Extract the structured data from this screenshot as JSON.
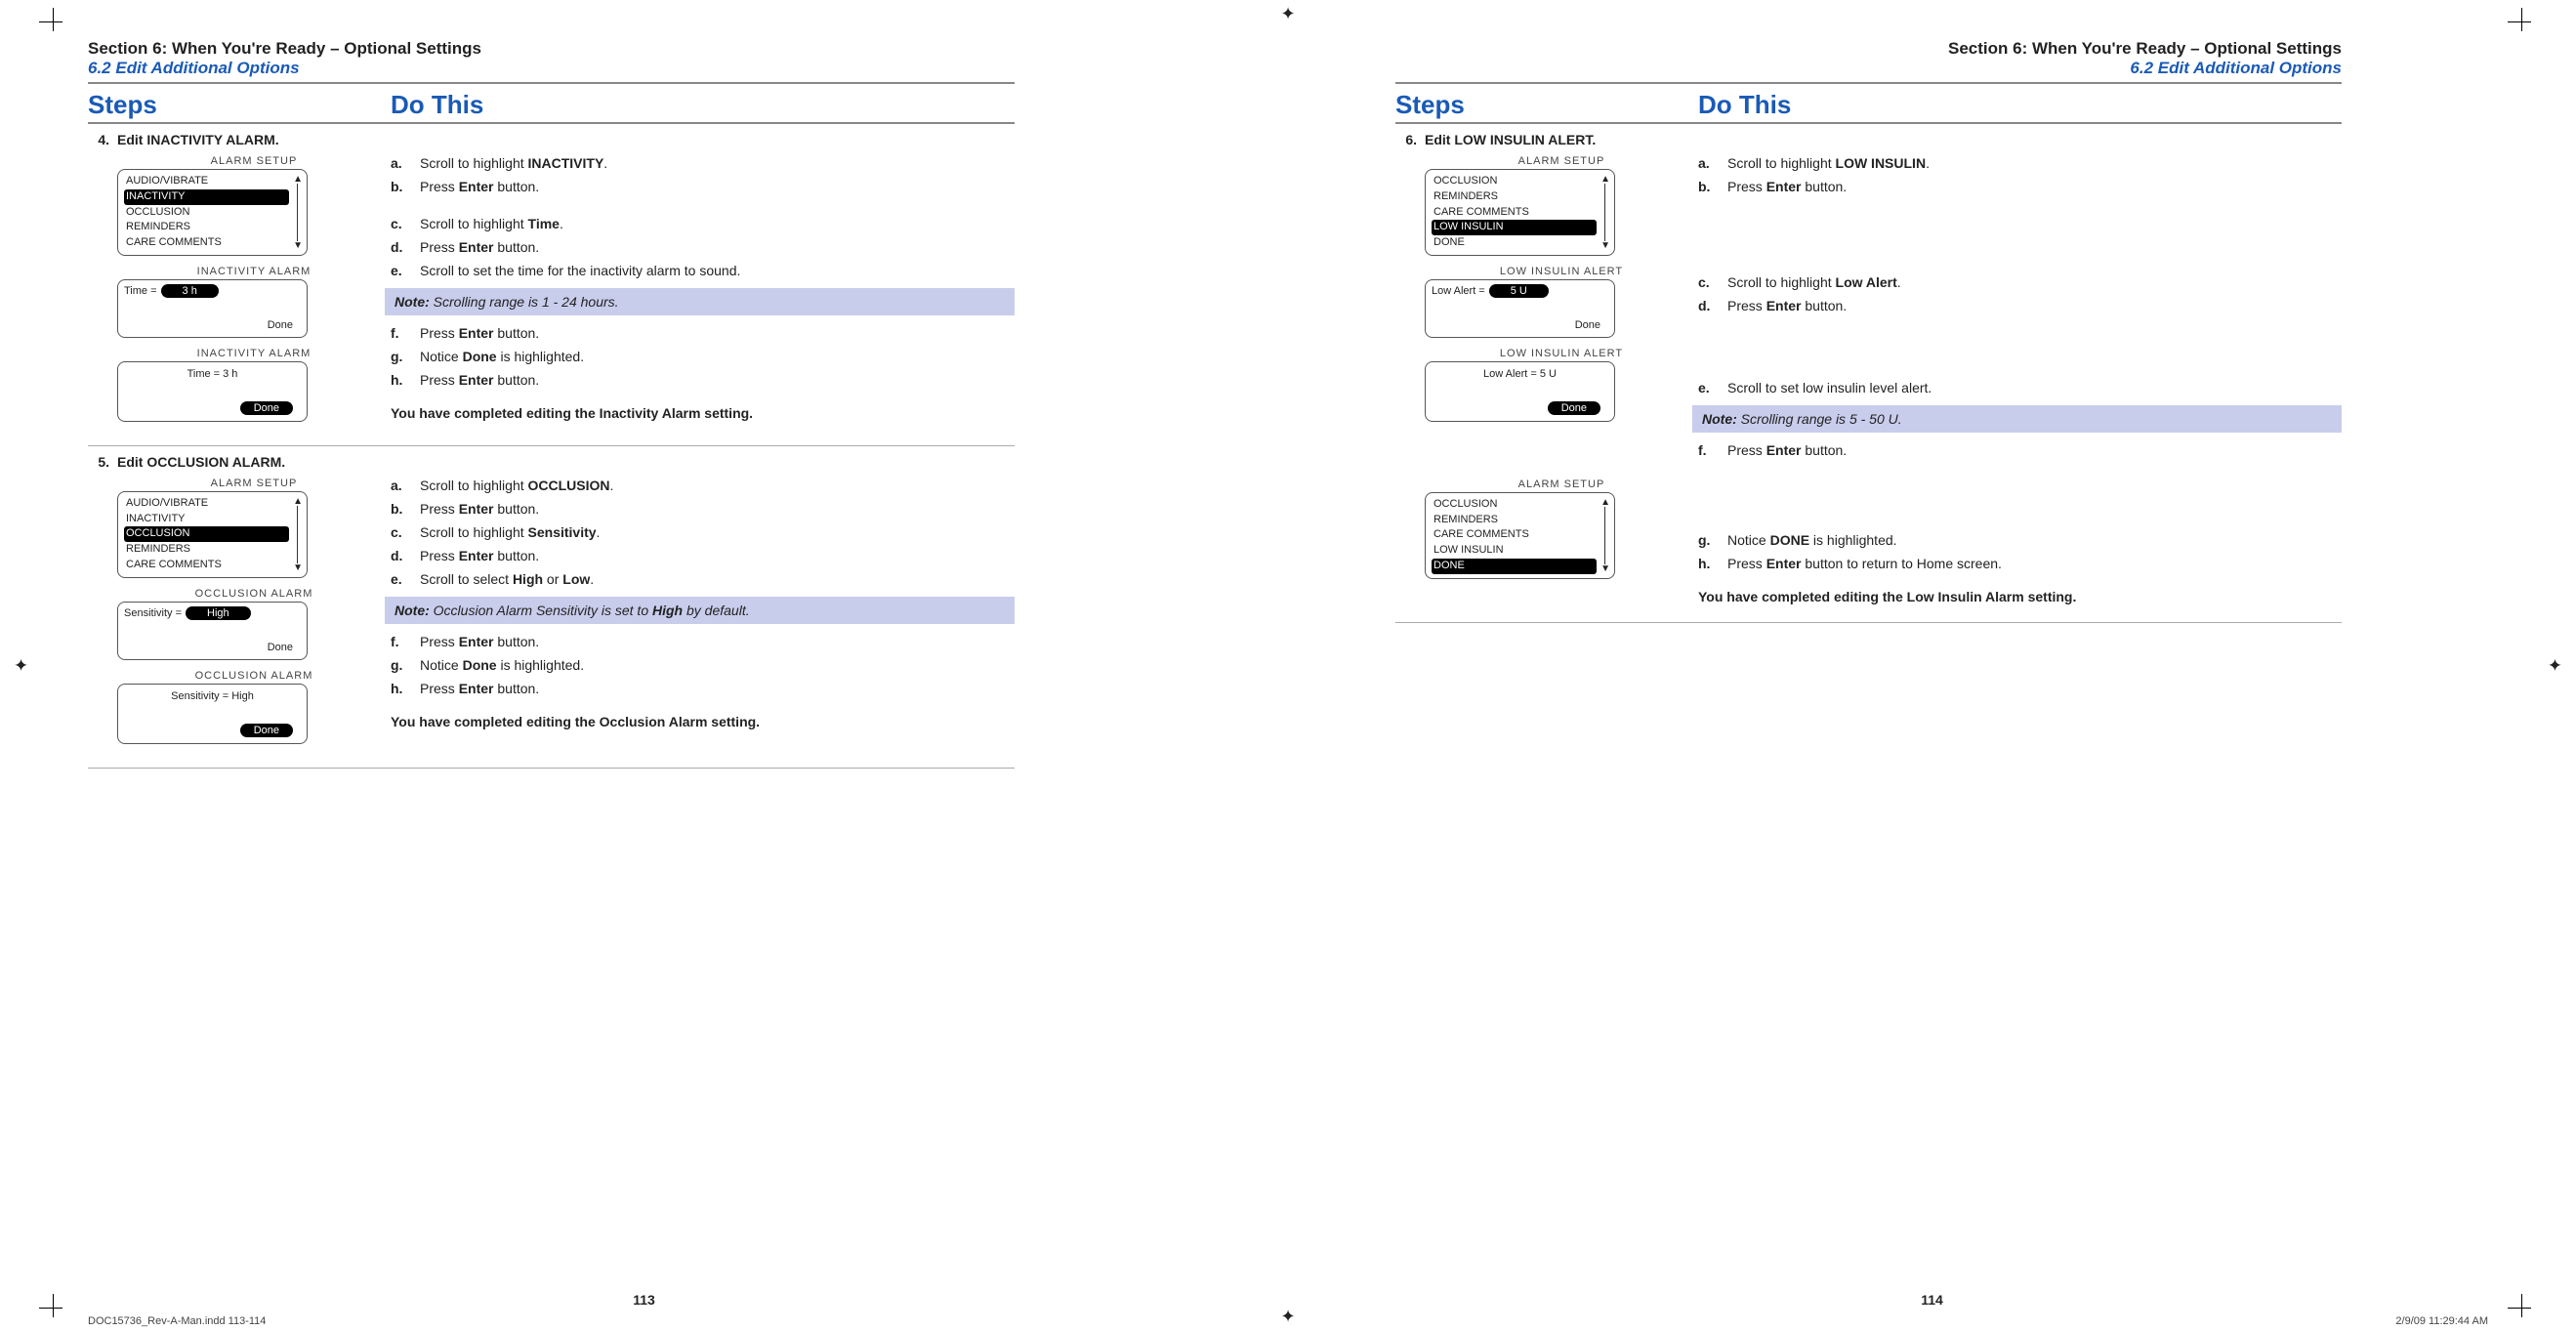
{
  "section_title": "Section 6: When You're Ready – Optional Settings",
  "subsection_title": "6.2 Edit Additional Options",
  "cols": {
    "steps": "Steps",
    "do": "Do This"
  },
  "left": {
    "pageno": "113",
    "steps": [
      {
        "num": "4.",
        "title": "Edit INACTIVITY ALARM.",
        "screens": [
          {
            "title": "ALARM SETUP",
            "type": "menu",
            "items": [
              "AUDIO/VIBRATE",
              "INACTIVITY",
              "OCCLUSION",
              "REMINDERS",
              "CARE COMMENTS"
            ],
            "sel": 1
          },
          {
            "title": "INACTIVITY ALARM",
            "type": "value",
            "key": "Time =",
            "val": "3 h",
            "done_plain": "Done"
          },
          {
            "title": "INACTIVITY ALARM",
            "type": "static",
            "line": "Time = 3 h",
            "done_pill": "Done"
          }
        ],
        "subs": [
          {
            "l": "a.",
            "t_a": "Scroll to highlight ",
            "t_b": "INACTIVITY",
            "t_c": "."
          },
          {
            "l": "b.",
            "t_a": "Press ",
            "t_b": "Enter",
            "t_c": " button."
          },
          {
            "gap": true
          },
          {
            "l": "c.",
            "t_a": "Scroll to highlight ",
            "t_b": "Time",
            "t_c": "."
          },
          {
            "l": "d.",
            "t_a": "Press ",
            "t_b": "Enter",
            "t_c": " button."
          },
          {
            "l": "e.",
            "t_a": "Scroll to set the time for the inactivity alarm to sound.",
            "t_b": "",
            "t_c": ""
          },
          {
            "note_a": "Note:",
            "note_b": " Scrolling range is 1 - 24 hours."
          },
          {
            "l": "f.",
            "t_a": "Press ",
            "t_b": "Enter",
            "t_c": " button."
          },
          {
            "l": "g.",
            "t_a": "Notice ",
            "t_b": "Done",
            "t_c": " is highlighted."
          },
          {
            "l": "h.",
            "t_a": "Press ",
            "t_b": "Enter",
            "t_c": " button."
          }
        ],
        "complete": "You have completed editing the Inactivity Alarm setting."
      },
      {
        "num": "5.",
        "title": "Edit OCCLUSION ALARM.",
        "screens": [
          {
            "title": "ALARM SETUP",
            "type": "menu",
            "items": [
              "AUDIO/VIBRATE",
              "INACTIVITY",
              "OCCLUSION",
              "REMINDERS",
              "CARE COMMENTS"
            ],
            "sel": 2
          },
          {
            "title": "OCCLUSION ALARM",
            "type": "value",
            "key": "Sensitivity =",
            "val": "High",
            "done_plain": "Done"
          },
          {
            "title": "OCCLUSION ALARM",
            "type": "static",
            "line": "Sensitivity = High",
            "done_pill": "Done"
          }
        ],
        "subs": [
          {
            "l": "a.",
            "t_a": "Scroll to highlight ",
            "t_b": "OCCLUSION",
            "t_c": "."
          },
          {
            "l": "b.",
            "t_a": "Press ",
            "t_b": "Enter",
            "t_c": " button."
          },
          {
            "l": "c.",
            "t_a": "Scroll to highlight ",
            "t_b": "Sensitivity",
            "t_c": "."
          },
          {
            "l": "d.",
            "t_a": "Press ",
            "t_b": "Enter",
            "t_c": " button."
          },
          {
            "l": "e.",
            "t_a": "Scroll to select ",
            "t_b": "High",
            "t_c": " or ",
            "t_d": "Low",
            "t_e": "."
          },
          {
            "note_a": "Note:",
            "note_b": " Occlusion Alarm Sensitivity is set to ",
            "note_c": "High",
            "note_d": " by default."
          },
          {
            "l": "f.",
            "t_a": "Press ",
            "t_b": "Enter",
            "t_c": " button."
          },
          {
            "l": "g.",
            "t_a": "Notice ",
            "t_b": "Done",
            "t_c": " is highlighted."
          },
          {
            "l": "h.",
            "t_a": "Press ",
            "t_b": "Enter",
            "t_c": " button."
          }
        ],
        "complete": "You have completed editing the Occlusion Alarm setting."
      }
    ]
  },
  "right": {
    "pageno": "114",
    "steps": [
      {
        "num": "6.",
        "title": "Edit LOW INSULIN ALERT.",
        "screens": [
          {
            "title": "ALARM SETUP",
            "type": "menu",
            "items": [
              "OCCLUSION",
              "REMINDERS",
              "CARE COMMENTS",
              "LOW INSULIN",
              "DONE"
            ],
            "sel": 3
          },
          {
            "title": "LOW INSULIN ALERT",
            "type": "value",
            "key": "Low Alert =",
            "val": "5 U",
            "done_plain": "Done"
          },
          {
            "title": "LOW INSULIN ALERT",
            "type": "static",
            "line": "Low Alert = 5 U",
            "done_pill": "Done"
          },
          {
            "spacer": 40
          },
          {
            "title": "ALARM SETUP",
            "type": "menu",
            "items": [
              "OCCLUSION",
              "REMINDERS",
              "CARE COMMENTS",
              "LOW INSULIN",
              "DONE"
            ],
            "sel": 4
          }
        ],
        "subs": [
          {
            "l": "a.",
            "t_a": "Scroll to highlight ",
            "t_b": "LOW INSULIN",
            "t_c": "."
          },
          {
            "l": "b.",
            "t_a": "Press ",
            "t_b": "Enter",
            "t_c": " button."
          },
          {
            "bigskip": 74
          },
          {
            "l": "c.",
            "t_a": "Scroll to highlight ",
            "t_b": "Low Alert",
            "t_c": "."
          },
          {
            "l": "d.",
            "t_a": "Press ",
            "t_b": "Enter",
            "t_c": " button."
          },
          {
            "bigskip": 60
          },
          {
            "l": "e.",
            "t_a": "Scroll to set low insulin level alert.",
            "t_b": "",
            "t_c": ""
          },
          {
            "note_a": "Note:",
            "note_b": " Scrolling range is 5 - 50 U."
          },
          {
            "l": "f.",
            "t_a": "Press ",
            "t_b": "Enter",
            "t_c": " button."
          },
          {
            "bigskip": 68
          },
          {
            "l": "g.",
            "t_a": "Notice ",
            "t_b": "DONE",
            "t_c": " is highlighted."
          },
          {
            "l": "h.",
            "t_a": "Press ",
            "t_b": "Enter",
            "t_c": " button to return to Home screen."
          }
        ],
        "complete": "You have completed editing the Low Insulin Alarm setting."
      }
    ]
  },
  "footer_left": "DOC15736_Rev-A-Man.indd   113-114",
  "footer_right": "2/9/09   11:29:44 AM"
}
